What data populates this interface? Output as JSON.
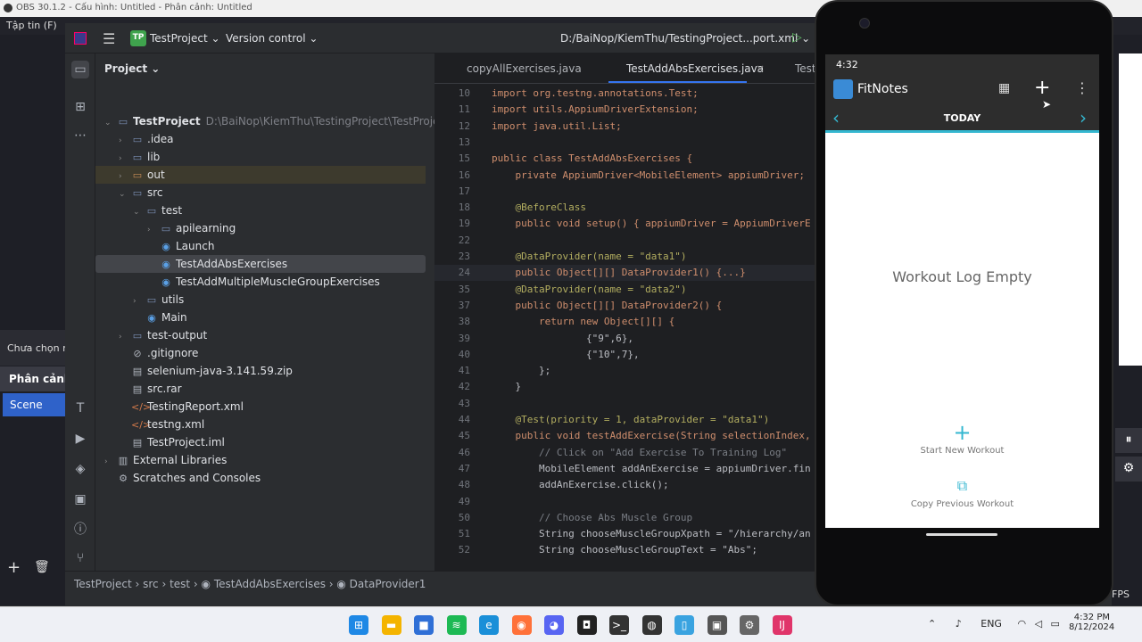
{
  "obs": {
    "title": "OBS 30.1.2 - Cấu hình: Untitled - Phân cảnh: Untitled",
    "menu_visible": "Tập tin (F)",
    "chua_chon": "Chưa chọn n",
    "phan_canh": "Phân cảnh",
    "scene": "Scene",
    "add": "+",
    "remove": "🗑",
    "pause_icon": "⏸",
    "gear_icon": "⚙",
    "fps": "FPS"
  },
  "ide": {
    "project_badge": "TP",
    "project_name": "TestProject ⌄",
    "vcs": "Version control ⌄",
    "file_path": "D:/BaiNop/KiemThu/TestingProject...port.xml ⌄",
    "panel_title": "Project ⌄",
    "tree": [
      {
        "label": "TestProject",
        "extra": "D:\\BaiNop\\KiemThu\\TestingProject\\TestProject",
        "arrow": "⌄",
        "icon": "▭",
        "type": "folder"
      },
      {
        "label": ".idea",
        "arrow": "›",
        "icon": "▭",
        "type": "folder"
      },
      {
        "label": "lib",
        "arrow": "›",
        "icon": "▭",
        "type": "folder"
      },
      {
        "label": "out",
        "arrow": "›",
        "icon": "▭",
        "type": "folder-o"
      },
      {
        "label": "src",
        "arrow": "⌄",
        "icon": "▭",
        "type": "folder"
      },
      {
        "label": "test",
        "arrow": "⌄",
        "icon": "▭",
        "type": "folder"
      },
      {
        "label": "apilearning",
        "arrow": "›",
        "icon": "▭",
        "type": "folder"
      },
      {
        "label": "Launch",
        "arrow": "",
        "icon": "◉",
        "type": "cls"
      },
      {
        "label": "TestAddAbsExercises",
        "arrow": "",
        "icon": "◉",
        "type": "cls"
      },
      {
        "label": "TestAddMultipleMuscleGroupExercises",
        "arrow": "",
        "icon": "◉",
        "type": "cls"
      },
      {
        "label": "utils",
        "arrow": "›",
        "icon": "▭",
        "type": "folder"
      },
      {
        "label": "Main",
        "arrow": "",
        "icon": "◉",
        "type": "cls"
      },
      {
        "label": "test-output",
        "arrow": "›",
        "icon": "▭",
        "type": "folder"
      },
      {
        "label": ".gitignore",
        "arrow": "",
        "icon": "⊘",
        "type": "file"
      },
      {
        "label": "selenium-java-3.141.59.zip",
        "arrow": "",
        "icon": "▤",
        "type": "file"
      },
      {
        "label": "src.rar",
        "arrow": "",
        "icon": "▤",
        "type": "file"
      },
      {
        "label": "TestingReport.xml",
        "arrow": "",
        "icon": "</>",
        "type": "xml"
      },
      {
        "label": "testng.xml",
        "arrow": "",
        "icon": "</>",
        "type": "xml"
      },
      {
        "label": "TestProject.iml",
        "arrow": "",
        "icon": "▤",
        "type": "file"
      },
      {
        "label": "External Libraries",
        "arrow": "›",
        "icon": "▥",
        "type": "file"
      },
      {
        "label": "Scratches and Consoles",
        "arrow": "",
        "icon": "⚙",
        "type": "file"
      }
    ],
    "tabs": [
      "copyAllExercises.java",
      "TestAddAbsExercises.java",
      "Test"
    ],
    "tab_close": "×",
    "code": [
      {
        "n": "10",
        "t": "import org.testng.annotations.Test;"
      },
      {
        "n": "11",
        "t": "import utils.AppiumDriverExtension;"
      },
      {
        "n": "12",
        "t": "import java.util.List;"
      },
      {
        "n": "13",
        "t": ""
      },
      {
        "n": "15",
        "t": "public class TestAddAbsExercises {"
      },
      {
        "n": "16",
        "t": "    private AppiumDriver<MobileElement> appiumDriver;"
      },
      {
        "n": "17",
        "t": ""
      },
      {
        "n": "18",
        "t": "    @BeforeClass"
      },
      {
        "n": "19",
        "t": "    public void setup() { appiumDriver = AppiumDriverE"
      },
      {
        "n": "22",
        "t": ""
      },
      {
        "n": "23",
        "t": "    @DataProvider(name = \"data1\")"
      },
      {
        "n": "24",
        "t": "    public Object[][] DataProvider1() {...}"
      },
      {
        "n": "35",
        "t": "    @DataProvider(name = \"data2\")"
      },
      {
        "n": "37",
        "t": "    public Object[][] DataProvider2() {"
      },
      {
        "n": "38",
        "t": "        return new Object[][] {"
      },
      {
        "n": "39",
        "t": "                {\"9\",6},"
      },
      {
        "n": "40",
        "t": "                {\"10\",7},"
      },
      {
        "n": "41",
        "t": "        };"
      },
      {
        "n": "42",
        "t": "    }"
      },
      {
        "n": "43",
        "t": ""
      },
      {
        "n": "44",
        "t": "    @Test(priority = 1, dataProvider = \"data1\")"
      },
      {
        "n": "45",
        "t": "    public void testAddExercise(String selectionIndex,"
      },
      {
        "n": "46",
        "t": "        // Click on \"Add Exercise To Training Log\""
      },
      {
        "n": "47",
        "t": "        MobileElement addAnExercise = appiumDriver.fin"
      },
      {
        "n": "48",
        "t": "        addAnExercise.click();"
      },
      {
        "n": "49",
        "t": ""
      },
      {
        "n": "50",
        "t": "        // Choose Abs Muscle Group"
      },
      {
        "n": "51",
        "t": "        String chooseMuscleGroupXpath = \"/hierarchy/an"
      },
      {
        "n": "52",
        "t": "        String chooseMuscleGroupText = \"Abs\";"
      }
    ],
    "breadcrumb": "TestProject  ›  src  ›  test  ›  ◉ TestAddAbsExercises  ›  ◉ DataProvider1"
  },
  "phone": {
    "time": "4:32",
    "app_title": "FitNotes",
    "date_label": "TODAY",
    "prev": "‹",
    "next": "›",
    "empty_text": "Workout Log Empty",
    "start_label": "Start New Workout",
    "copy_label": "Copy Previous Workout",
    "plus": "+",
    "menu": "⋮",
    "calendar": "▦",
    "start_icon": "+",
    "copy_icon": "⧉",
    "accent": "#34b7d0"
  },
  "taskbar": {
    "lang": "ENG",
    "time": "4:32 PM",
    "date": "8/12/2024",
    "chevron": "⌃",
    "icons": [
      {
        "name": "windows-start",
        "color": "#1e88e5",
        "glyph": "⊞"
      },
      {
        "name": "file-explorer",
        "color": "#f4b400",
        "glyph": "▬"
      },
      {
        "name": "store",
        "color": "#2f6fd6",
        "glyph": "■"
      },
      {
        "name": "spotify",
        "color": "#1db954",
        "glyph": "≋"
      },
      {
        "name": "edge",
        "color": "#1a8fd8",
        "glyph": "e"
      },
      {
        "name": "firefox",
        "color": "#ff7139",
        "glyph": "◉"
      },
      {
        "name": "discord",
        "color": "#5865f2",
        "glyph": "◕"
      },
      {
        "name": "app-yellow",
        "color": "#222222",
        "glyph": "◘"
      },
      {
        "name": "terminal",
        "color": "#333333",
        "glyph": ">_"
      },
      {
        "name": "obs",
        "color": "#333333",
        "glyph": "◍"
      },
      {
        "name": "android-studio",
        "color": "#3aa3e0",
        "glyph": "▯"
      },
      {
        "name": "emulator",
        "color": "#555555",
        "glyph": "▣"
      },
      {
        "name": "settings",
        "color": "#666666",
        "glyph": "⚙"
      },
      {
        "name": "intellij",
        "color": "#e0356a",
        "glyph": "IJ"
      }
    ]
  }
}
